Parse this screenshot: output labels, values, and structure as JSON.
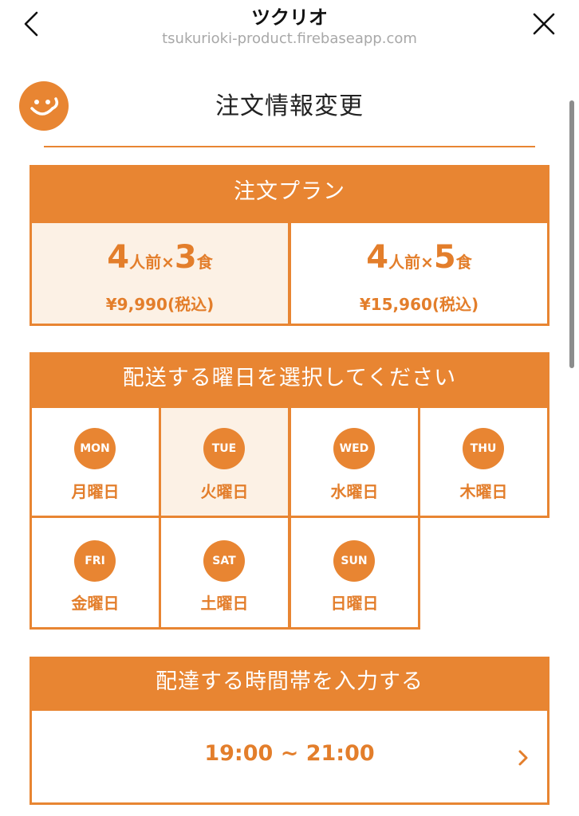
{
  "browser": {
    "title": "ツクリオ",
    "url": "tsukurioki-product.firebaseapp.com",
    "back_icon": "chevron-left-icon",
    "close_icon": "close-icon"
  },
  "header": {
    "logo_icon": "smile-logo-icon",
    "page_title": "注文情報変更"
  },
  "colors": {
    "accent": "#e88532",
    "selected_bg": "#fcf1e5"
  },
  "plan": {
    "heading": "注文プラン",
    "options": [
      {
        "servings_num": "4",
        "servings_unit": "人前",
        "times": "×",
        "meals_num": "3",
        "meals_unit": "食",
        "price": "¥9,990(税込)",
        "selected": true
      },
      {
        "servings_num": "4",
        "servings_unit": "人前",
        "times": "×",
        "meals_num": "5",
        "meals_unit": "食",
        "price": "¥15,960(税込)",
        "selected": false
      }
    ]
  },
  "days": {
    "heading": "配送する曜日を選択してください",
    "items": [
      {
        "abbr": "MON",
        "label": "月曜日",
        "selected": false
      },
      {
        "abbr": "TUE",
        "label": "火曜日",
        "selected": true
      },
      {
        "abbr": "WED",
        "label": "水曜日",
        "selected": false
      },
      {
        "abbr": "THU",
        "label": "木曜日",
        "selected": false
      },
      {
        "abbr": "FRI",
        "label": "金曜日",
        "selected": false
      },
      {
        "abbr": "SAT",
        "label": "土曜日",
        "selected": false
      },
      {
        "abbr": "SUN",
        "label": "日曜日",
        "selected": false
      }
    ]
  },
  "time": {
    "heading": "配達する時間帯を入力する",
    "value": "19:00 ~ 21:00",
    "chevron_icon": "chevron-right-icon"
  }
}
